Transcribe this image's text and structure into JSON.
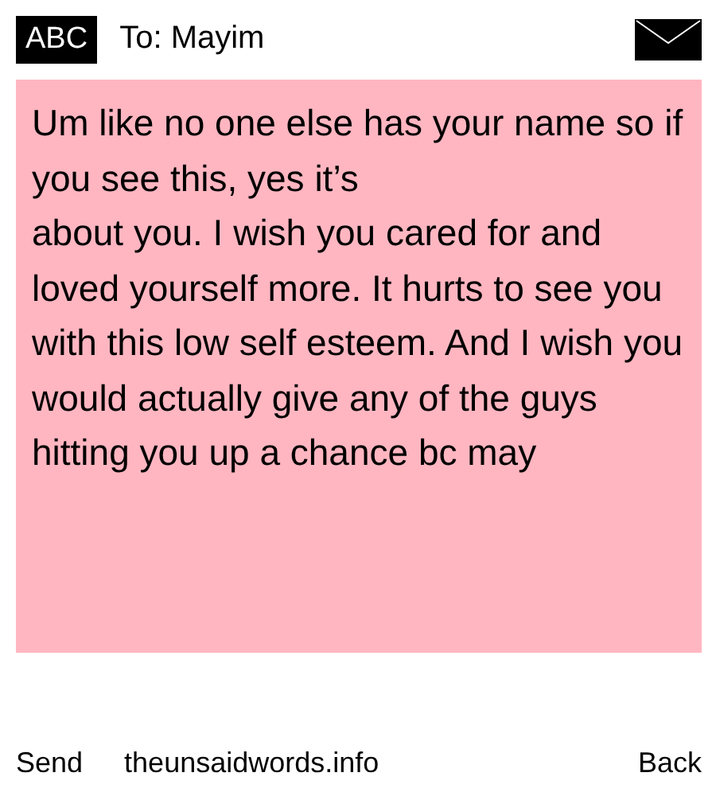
{
  "header": {
    "input_mode": "ABC",
    "recipient": "To: Mayim"
  },
  "message": {
    "text": "Um like no one else has your name so if you see this, yes it’s\nabout you. I wish you cared for and loved yourself more. It hurts to see you with this low self esteem. And I wish you would actually give any of the guys hitting you up a chance bc may"
  },
  "footer": {
    "left_softkey": "Send",
    "site": "theunsaidwords.info",
    "right_softkey": "Back"
  }
}
